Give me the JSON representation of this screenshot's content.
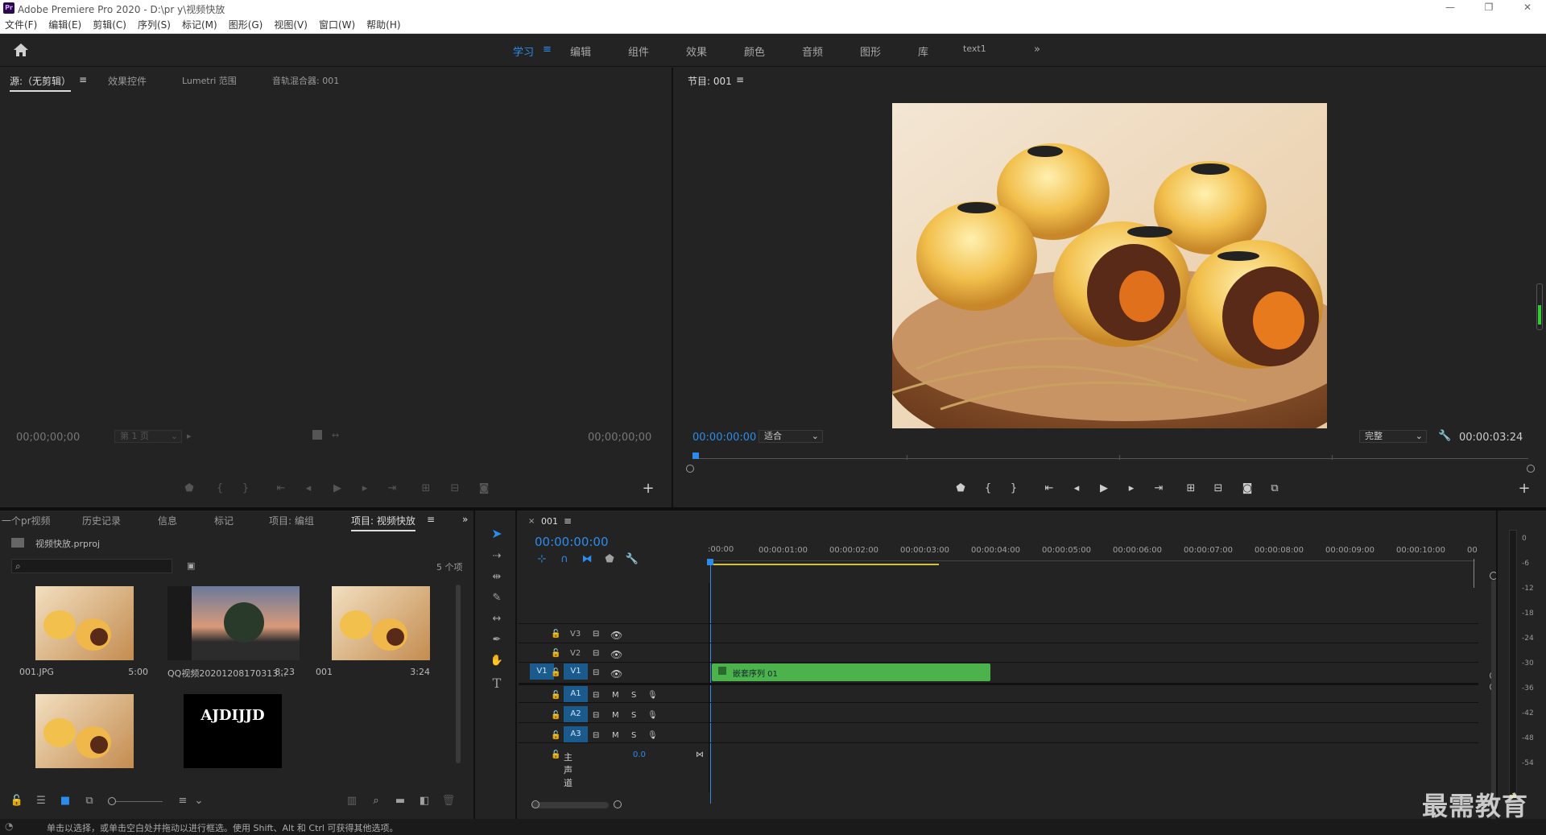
{
  "app": {
    "title": "Adobe Premiere Pro 2020 - D:\\pr y\\视频快放",
    "logo_text": "Pr",
    "window_buttons": [
      "—",
      "❐",
      "✕"
    ]
  },
  "menu": [
    "文件(F)",
    "编辑(E)",
    "剪辑(C)",
    "序列(S)",
    "标记(M)",
    "图形(G)",
    "视图(V)",
    "窗口(W)",
    "帮助(H)"
  ],
  "workspaces": {
    "items": [
      "学习",
      "编辑",
      "组件",
      "效果",
      "颜色",
      "音频",
      "图形",
      "库",
      "text1"
    ],
    "active": "学习",
    "more": "»"
  },
  "source_panel": {
    "tabs": [
      "源:（无剪辑）",
      "效果控件",
      "Lumetri 范围",
      "音轨混合器: 001"
    ],
    "timecode_left": "00;00;00;00",
    "timecode_right": "00;00;00;00",
    "page_select": "第 1 页"
  },
  "program_panel": {
    "tab": "节目: 001",
    "timecode": "00:00:00:00",
    "fit_select": "适合",
    "quality_select": "完整",
    "duration": "00:00:03:24"
  },
  "project_panel": {
    "tabs": [
      "一个pr视频",
      "历史记录",
      "信息",
      "标记",
      "项目: 编组",
      "项目: 视频快放"
    ],
    "active_tab": "项目: 视频快放",
    "project_file": "视频快放.prproj",
    "item_count": "5 个项",
    "items": [
      {
        "name": "001.JPG",
        "duration": "5:00"
      },
      {
        "name": "QQ视频20201208170313...",
        "duration": "8;23"
      },
      {
        "name": "001",
        "duration": "3:24"
      },
      {
        "name": "",
        "duration": ""
      },
      {
        "name": "",
        "duration": "",
        "text": "AJDIJJD"
      }
    ]
  },
  "timeline": {
    "tab": "001",
    "timecode": "00:00:00:00",
    "ruler": [
      ":00:00",
      "00:00:01:00",
      "00:00:02:00",
      "00:00:03:00",
      "00:00:04:00",
      "00:00:05:00",
      "00:00:06:00",
      "00:00:07:00",
      "00:00:08:00",
      "00:00:09:00",
      "00:00:10:00",
      "00"
    ],
    "video_tracks": [
      "V3",
      "V2",
      "V1"
    ],
    "audio_tracks": [
      "A1",
      "A2",
      "A3"
    ],
    "source_patch": "V1",
    "master_label": "主声道",
    "master_value": "0.0",
    "clip_label": "嵌套序列 01",
    "mute": "M",
    "solo": "S"
  },
  "audio_meter": {
    "labels": [
      "0",
      "-6",
      "-12",
      "-18",
      "-24",
      "-30",
      "-36",
      "-42",
      "-48",
      "-54"
    ]
  },
  "status_bar": {
    "text": "单击以选择，或单击空白处并拖动以进行框选。使用 Shift、Alt 和 Ctrl 可获得其他选项。"
  },
  "watermark": "最需教育",
  "colors": {
    "accent_blue": "#2d8ceb",
    "clip_green": "#4cb34c",
    "track_chip": "#1b5a8c",
    "panel_bg": "#232323"
  }
}
